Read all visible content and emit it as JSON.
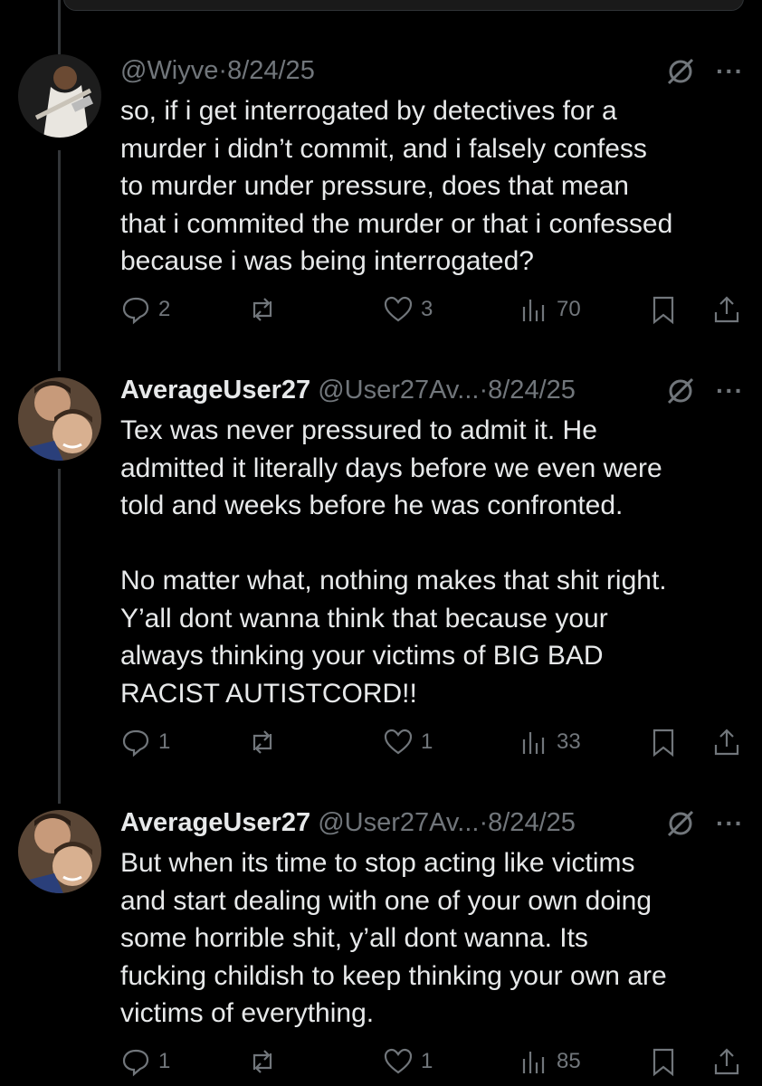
{
  "tweets": [
    {
      "name": "",
      "handle": "@Wiyve",
      "date": "8/24/25",
      "text": [
        "so, if i get interrogated by detectives for a",
        "murder i didn’t commit, and i falsely confess",
        "to murder under pressure, does that mean",
        "that i commited the murder or that i confessed",
        "because i was being interrogated?"
      ],
      "replies": "2",
      "reposts": "",
      "likes": "3",
      "views": "70"
    },
    {
      "name": "AverageUser27",
      "handle": "@User27Av...",
      "date": "8/24/25",
      "text": [
        "Tex was never pressured to admit it. He",
        "admitted it literally days before we even were",
        "told and weeks before he was confronted.",
        "",
        "No matter what, nothing makes that shit right.",
        "Y’all dont wanna think that because your",
        "always thinking your victims of BIG BAD",
        "RACIST AUTISTCORD!!"
      ],
      "replies": "1",
      "reposts": "",
      "likes": "1",
      "views": "33"
    },
    {
      "name": "AverageUser27",
      "handle": "@User27Av...",
      "date": "8/24/25",
      "text": [
        "But when its time to stop acting like victims",
        "and start dealing with one of your own doing",
        "some horrible shit, y’all dont wanna. Its",
        "fucking childish to keep thinking your own are",
        "victims of everything."
      ],
      "replies": "1",
      "reposts": "",
      "likes": "1",
      "views": "85"
    }
  ],
  "ui": {
    "separator": "·",
    "more": "···"
  },
  "icons": {
    "reply": "reply-icon",
    "repost": "repost-icon",
    "like": "heart-icon",
    "views": "views-icon",
    "bookmark": "bookmark-icon",
    "share": "share-icon",
    "grok": "grok-icon",
    "more": "more-icon"
  },
  "colors": {
    "background": "#000000",
    "text": "#e7e9ea",
    "muted": "#71767b",
    "thread_line": "#333639"
  }
}
